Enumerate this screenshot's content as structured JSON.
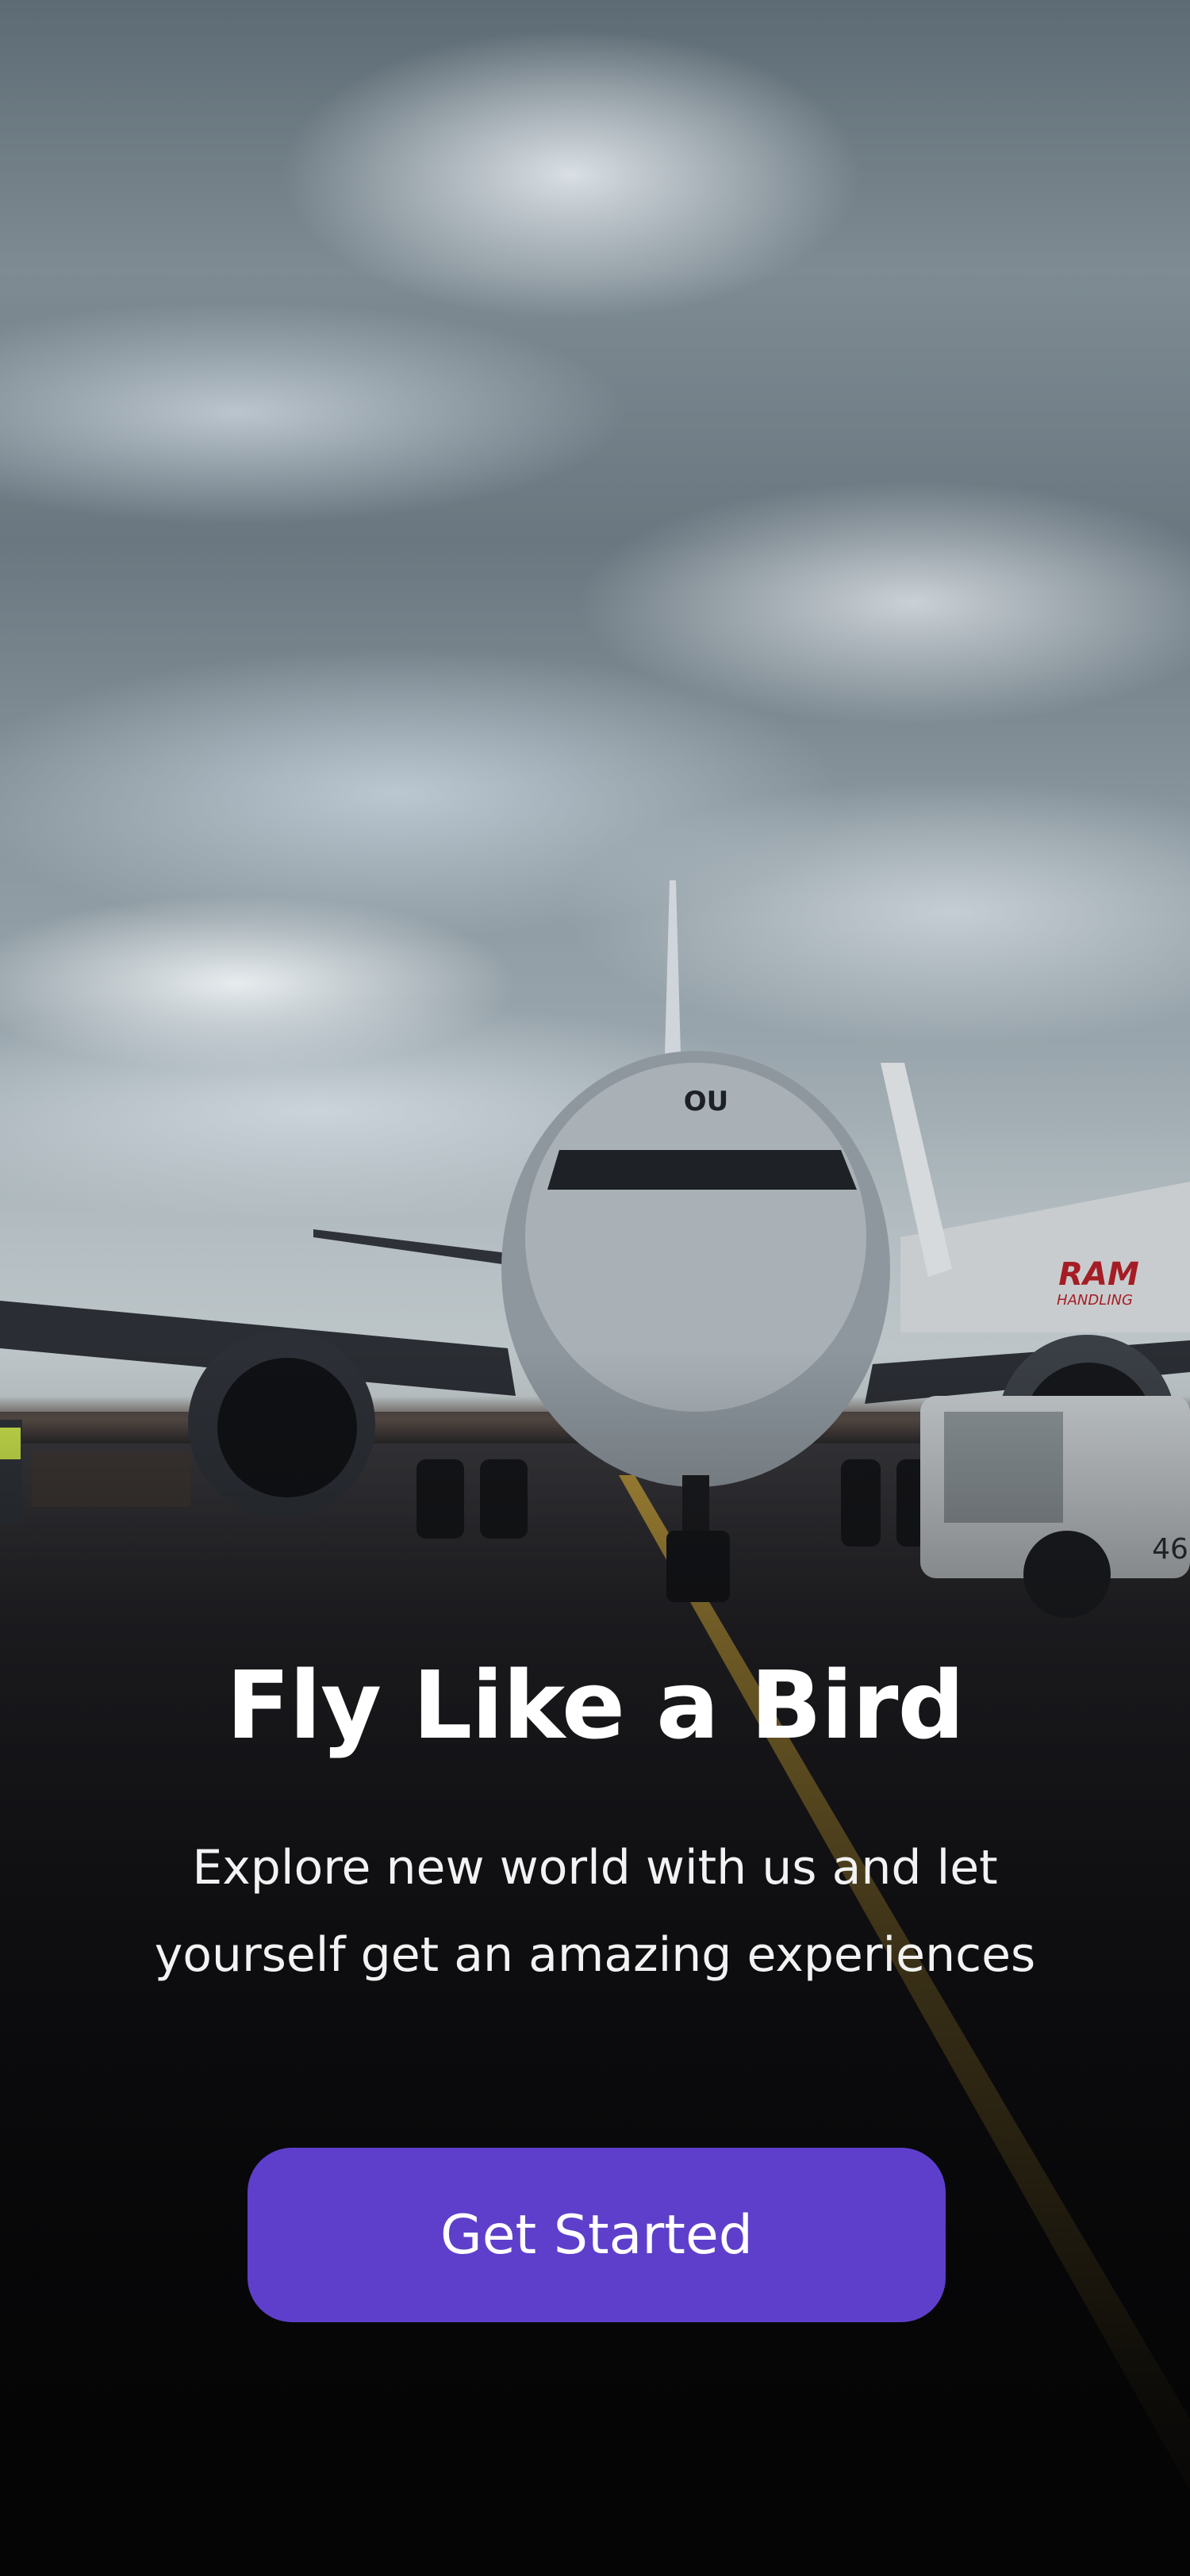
{
  "onboarding": {
    "title": "Fly Like a Bird",
    "subtitle": "Explore new world with us and let yourself get an amazing experiences",
    "cta_label": "Get Started"
  },
  "background": {
    "aircraft_nose_marking": "OU",
    "stairs_truck_logo": "RAM",
    "stairs_truck_sublabel": "HANDLING",
    "vehicle_number": "46"
  },
  "colors": {
    "accent": "#5E3FCB",
    "text": "#FFFFFF",
    "taxi_line": "#C9A23A",
    "background_dark": "#070608"
  }
}
